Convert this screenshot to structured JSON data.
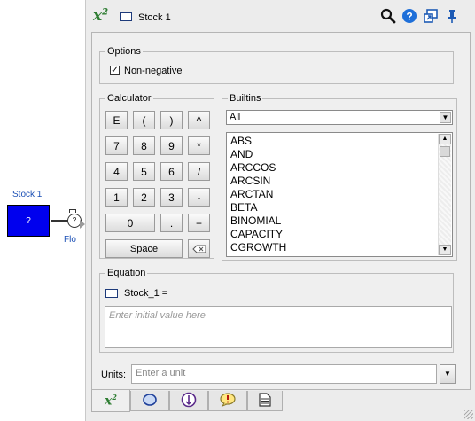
{
  "canvas": {
    "stock_label": "Stock 1",
    "stock_value": "?",
    "flow_label": "Flo"
  },
  "header": {
    "title_icon": "x-squared-equation-icon",
    "entity_name": "Stock 1",
    "icons": [
      "search-icon",
      "help-icon",
      "navigate-icon",
      "pin-icon"
    ]
  },
  "options": {
    "title": "Options",
    "non_negative_label": "Non-negative",
    "non_negative_checked": true
  },
  "calculator": {
    "title": "Calculator",
    "rows": [
      [
        "E",
        "(",
        ")",
        "^"
      ],
      [
        "7",
        "8",
        "9",
        "*"
      ],
      [
        "4",
        "5",
        "6",
        "/"
      ],
      [
        "1",
        "2",
        "3",
        "-"
      ],
      [
        "0",
        ".",
        "+"
      ]
    ],
    "space_label": "Space",
    "backspace_icon": "backspace-icon"
  },
  "builtins": {
    "title": "Builtins",
    "selected_category": "All",
    "functions": [
      "ABS",
      "AND",
      "ARCCOS",
      "ARCSIN",
      "ARCTAN",
      "BETA",
      "BINOMIAL",
      "CAPACITY",
      "CGROWTH"
    ]
  },
  "equation": {
    "title": "Equation",
    "label": "Stock_1 =",
    "placeholder": "Enter initial value here"
  },
  "units": {
    "label": "Units:",
    "placeholder": "Enter a unit"
  },
  "tabs": [
    {
      "icon": "equation-tab-icon",
      "label": "x",
      "sup": "2",
      "active": true
    },
    {
      "icon": "style-tab-icon",
      "active": false
    },
    {
      "icon": "info-tab-icon",
      "active": false
    },
    {
      "icon": "warning-tab-icon",
      "active": false
    },
    {
      "icon": "document-tab-icon",
      "active": false
    }
  ],
  "colors": {
    "stock_fill": "#0000ee",
    "label_blue": "#1a4fb5",
    "equation_green": "#2e7d32",
    "help_blue": "#1e6fd9"
  }
}
